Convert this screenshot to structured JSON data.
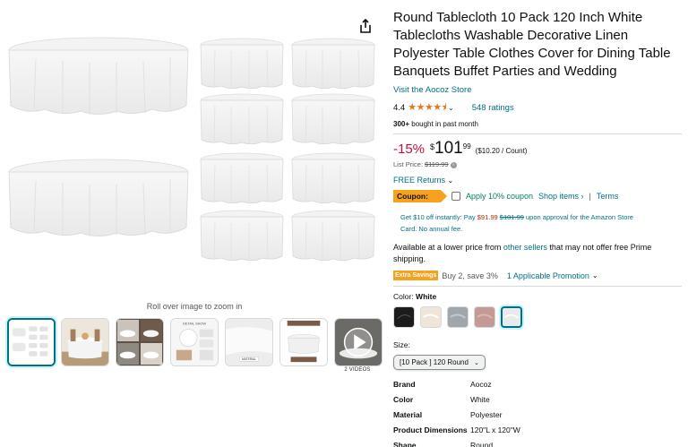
{
  "gallery": {
    "zoom_hint": "Roll over image to zoom in",
    "videos_label": "2 VIDEOS",
    "thumbnails": [
      {
        "name": "thumb-pack-overview",
        "selected": true
      },
      {
        "name": "thumb-dining-table",
        "selected": false
      },
      {
        "name": "thumb-event-collage",
        "selected": false
      },
      {
        "name": "thumb-detail-show",
        "selected": false
      },
      {
        "name": "thumb-material",
        "selected": false
      },
      {
        "name": "thumb-size-chart",
        "selected": false
      },
      {
        "name": "thumb-video",
        "selected": false
      }
    ],
    "thumb_detail_show": "DETAIL SHOW",
    "thumb_material": "MATERIAL"
  },
  "product": {
    "title": "Round Tablecloth 10 Pack 120 Inch White Tablecloths Washable Decorative Linen Polyester Table Clothes Cover for Dining Table Banquets Buffet Parties and Wedding",
    "store_link": "Visit the Aocoz Store",
    "rating": "4.4",
    "stars": "★★★★⯨",
    "ratings_count": "548 ratings",
    "bought_bold": "300+",
    "bought_rest": " bought in past month",
    "discount": "-15%",
    "price_symbol": "$",
    "price_whole": "101",
    "price_fraction": "99",
    "unit_price": "($10.20 / Count)",
    "list_price_label": "List Price: ",
    "list_price": "$119.99",
    "returns": "FREE Returns",
    "coupon_badge": "Coupon:",
    "coupon_text": "Apply 10% coupon",
    "shop_items": "Shop items ›",
    "separator": "|",
    "terms": "Terms",
    "offer_line1_a": "Get $10 off instantly: Pay ",
    "offer_pay": "$91.99",
    "offer_old": "$101.99",
    "offer_line1_b": " upon approval for the Amazon Store",
    "offer_line2": "Card. No annual fee.",
    "lower_a": "Available at a lower price from ",
    "lower_link": "other sellers",
    "lower_b": " that may not offer free Prime shipping.",
    "extra_badge": "Extra Savings",
    "promo_text": "Buy 2, save 3%",
    "promo_link": "1 Applicable Promotion",
    "color_label": "Color: ",
    "color_value": "White",
    "swatches": [
      "black",
      "ivory",
      "gray",
      "blush",
      "white"
    ],
    "size_label": "Size:",
    "size_value": "[10 Pack ] 120 Round",
    "specs": [
      {
        "key": "Brand",
        "value": "Aocoz"
      },
      {
        "key": "Color",
        "value": "White"
      },
      {
        "key": "Material",
        "value": "Polyester"
      },
      {
        "key": "Product Dimensions",
        "value": "120\"L x 120\"W"
      },
      {
        "key": "Shape",
        "value": "Round"
      }
    ]
  },
  "colors": {
    "link": "#007185",
    "discount": "#cc0c39",
    "star": "#de7921",
    "coupon": "#f7a21f",
    "coupon_green": "#067d62"
  }
}
